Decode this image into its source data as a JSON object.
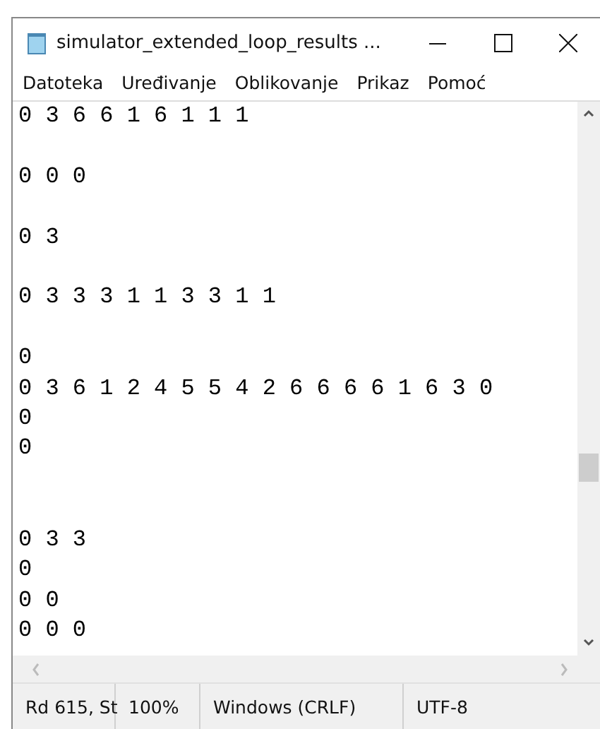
{
  "window": {
    "title": "simulator_extended_loop_results ..."
  },
  "menu": [
    {
      "label": "Datoteka"
    },
    {
      "label": "Uređivanje"
    },
    {
      "label": "Oblikovanje"
    },
    {
      "label": "Prikaz"
    },
    {
      "label": "Pomoć"
    }
  ],
  "editor": {
    "text": "0 3 6 6 1 6 1 1 1\n\n0 0 0\n\n0 3\n\n0 3 3 3 1 1 3 3 1 1\n\n0\n0 3 6 1 2 4 5 5 4 2 6 6 6 6 1 6 3 0\n0\n0\n\n\n0 3 3\n0\n0 0\n0 0 0"
  },
  "status_bar": [
    {
      "text": "Rd 615, St"
    },
    {
      "text": "100%"
    },
    {
      "text": "Windows (CRLF)"
    },
    {
      "text": "UTF-8"
    }
  ]
}
